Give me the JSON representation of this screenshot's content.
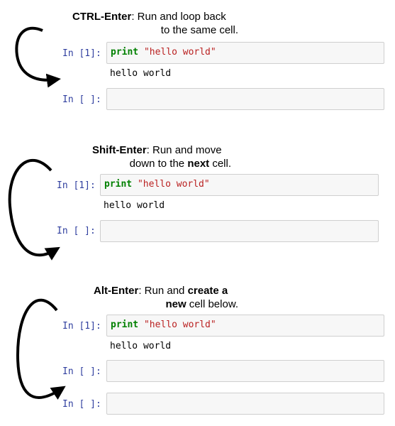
{
  "sections": [
    {
      "caption": {
        "line1": [
          {
            "text": "CTRL-Enter",
            "bold": true
          },
          {
            "text": ": Run and loop back",
            "bold": false
          }
        ],
        "line2": [
          {
            "text": "to the same cell.",
            "bold": false
          }
        ]
      },
      "cells": [
        {
          "prompt": "In [1]:",
          "keyword": "print",
          "string": "\"hello world\"",
          "output": "hello world"
        },
        {
          "prompt": "In [ ]:"
        }
      ]
    },
    {
      "caption": {
        "line1": [
          {
            "text": "Shift-Enter",
            "bold": true
          },
          {
            "text": ": Run and move",
            "bold": false
          }
        ],
        "line2": [
          {
            "text": "down to the ",
            "bold": false
          },
          {
            "text": "next",
            "bold": true
          },
          {
            "text": " cell.",
            "bold": false
          }
        ]
      },
      "cells": [
        {
          "prompt": "In [1]:",
          "keyword": "print",
          "string": "\"hello world\"",
          "output": "hello world"
        },
        {
          "prompt": "In [ ]:"
        }
      ]
    },
    {
      "caption": {
        "line1": [
          {
            "text": "Alt-Enter",
            "bold": true
          },
          {
            "text": ": Run and ",
            "bold": false
          },
          {
            "text": "create a",
            "bold": true
          }
        ],
        "line2": [
          {
            "text": "new",
            "bold": true
          },
          {
            "text": " cell below.",
            "bold": false
          }
        ]
      },
      "cells": [
        {
          "prompt": "In [1]:",
          "keyword": "print",
          "string": "\"hello world\"",
          "output": "hello world"
        },
        {
          "prompt": "In [ ]:"
        },
        {
          "prompt": "In [ ]:"
        }
      ]
    }
  ],
  "colors": {
    "prompt": "#303f9f",
    "keyword": "#008000",
    "string": "#ba2121",
    "cell_bg": "#f7f7f7",
    "cell_border": "#cfcfcf"
  }
}
